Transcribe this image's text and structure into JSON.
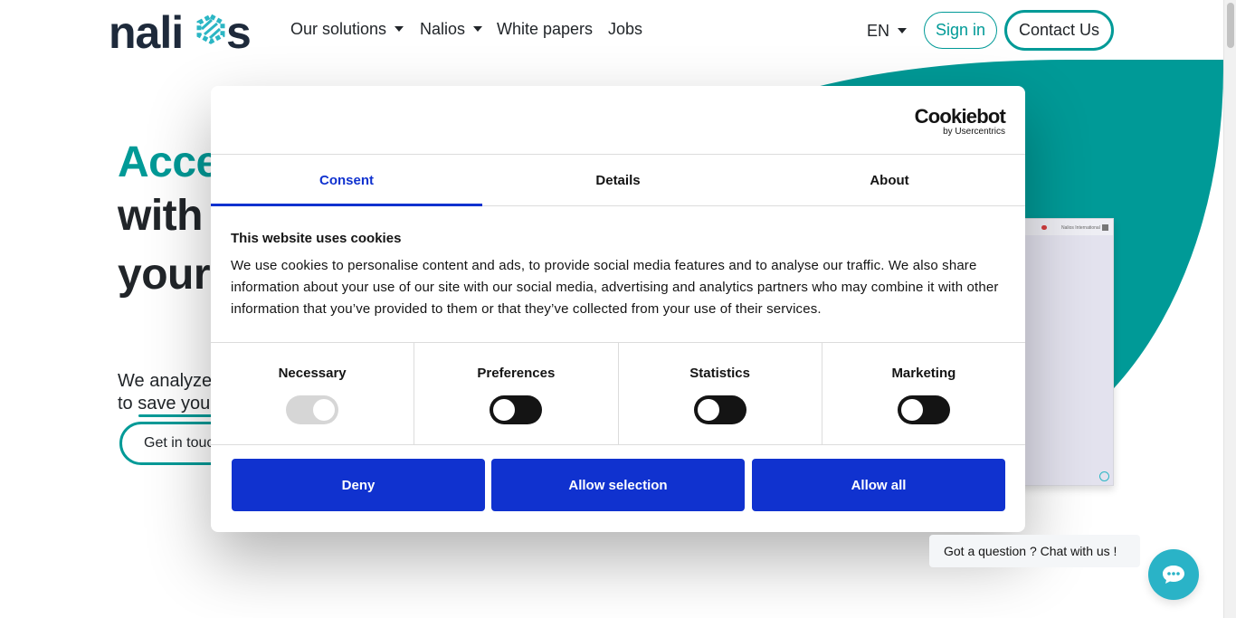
{
  "nav": {
    "logo_text": "nalios",
    "items": [
      {
        "label": "Our solutions",
        "dropdown": true
      },
      {
        "label": "Nalios",
        "dropdown": true
      },
      {
        "label": "White papers",
        "dropdown": false
      },
      {
        "label": "Jobs",
        "dropdown": false
      }
    ],
    "language": "EN",
    "signin_label": "Sign in",
    "contact_label": "Contact Us",
    "accent_color": "#009a97"
  },
  "hero": {
    "title_line1": "Acce",
    "title_line2": "with",
    "title_line3": "your",
    "subtitle_line1": "We analyze",
    "subtitle_line2": "to save you",
    "cta_label": "Get in touc",
    "mockup_text": "Nalios International"
  },
  "cookie_dialog": {
    "brand": "Cookiebot",
    "brand_sub": "by Usercentrics",
    "tabs": [
      {
        "label": "Consent",
        "active": true
      },
      {
        "label": "Details",
        "active": false
      },
      {
        "label": "About",
        "active": false
      }
    ],
    "title": "This website uses cookies",
    "body": "We use cookies to personalise content and ads, to provide social media features and to analyse our traffic. We also share information about your use of our site with our social media, advertising and analytics partners who may combine it with other information that you’ve provided to them or that they’ve collected from your use of their services.",
    "categories": [
      {
        "label": "Necessary",
        "enabled": true,
        "disabled": true
      },
      {
        "label": "Preferences",
        "enabled": false,
        "disabled": false
      },
      {
        "label": "Statistics",
        "enabled": false,
        "disabled": false
      },
      {
        "label": "Marketing",
        "enabled": false,
        "disabled": false
      }
    ],
    "buttons": {
      "deny": "Deny",
      "allow_selection": "Allow selection",
      "allow_all": "Allow all"
    },
    "primary_color": "#1032cf"
  },
  "chat": {
    "prompt": "Got a question ? Chat with us !",
    "icon": "chat-icon",
    "color": "#2ab3c7"
  }
}
